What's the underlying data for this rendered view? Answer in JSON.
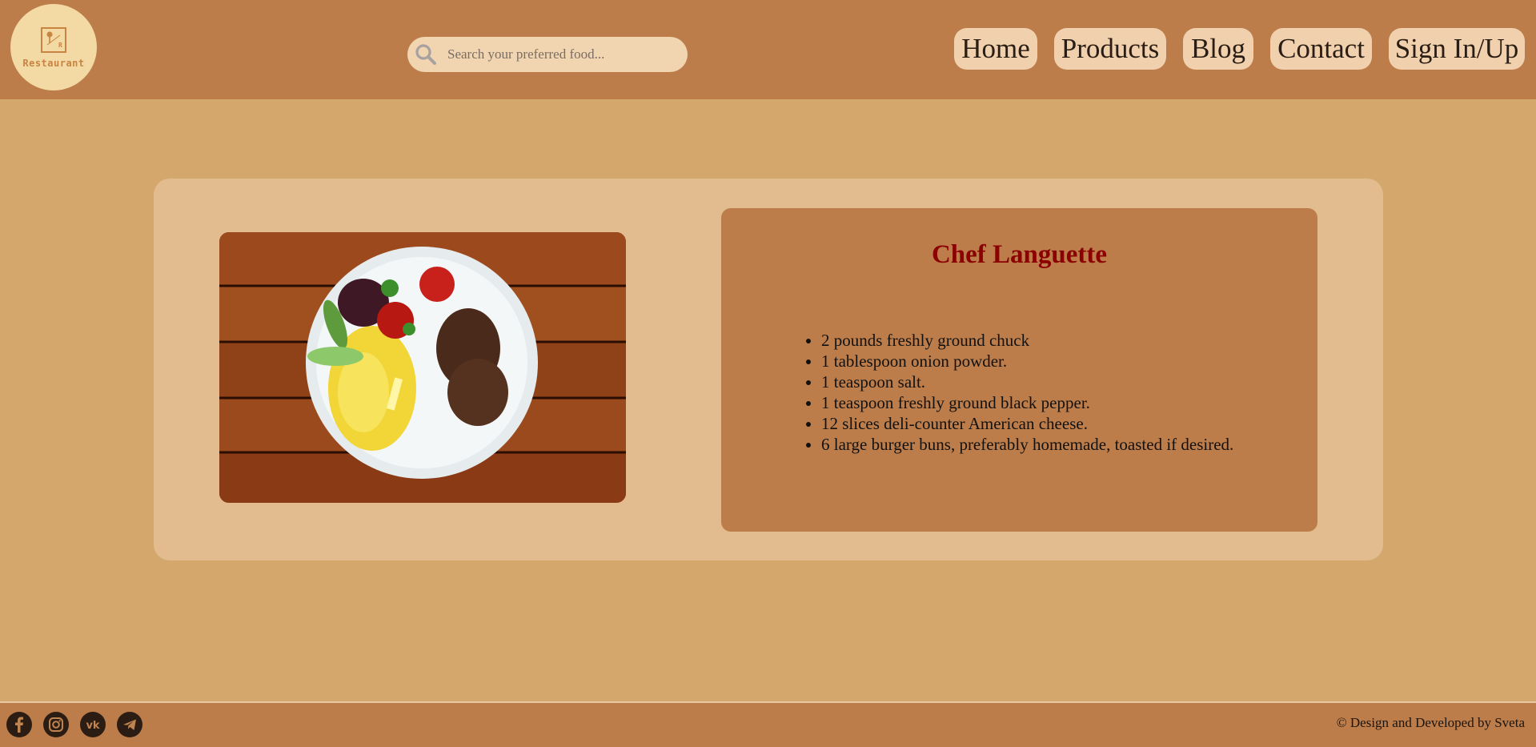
{
  "header": {
    "logo_text": "Restaurant",
    "search_placeholder": "Search your preferred food...",
    "nav": [
      "Home",
      "Products",
      "Blog",
      "Contact",
      "Sign In/Up"
    ]
  },
  "main": {
    "chef_title": "Chef Languette",
    "ingredients": [
      "2 pounds freshly ground chuck",
      "1 tablespoon onion powder.",
      "1 teaspoon salt.",
      "1 teaspoon freshly ground black pepper.",
      "12 slices deli-counter American cheese.",
      "6 large burger buns, preferably homemade, toasted if desired."
    ]
  },
  "footer": {
    "social_icons": [
      "facebook-icon",
      "instagram-icon",
      "vk-icon",
      "telegram-icon"
    ],
    "copyright": "© Design and Developed by Sveta"
  },
  "colors": {
    "header_bg": "#bd7d4a",
    "page_bg": "#d4a76c",
    "card_bg": "#e2bb8e",
    "nav_button_bg": "#f0d0ad",
    "title_color": "#8b0000"
  }
}
